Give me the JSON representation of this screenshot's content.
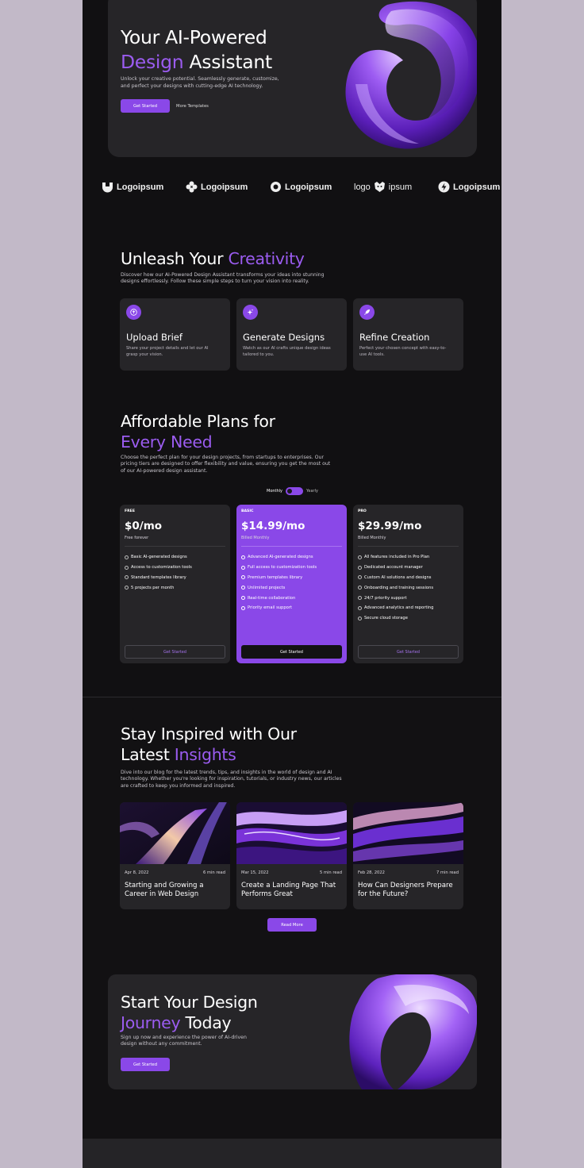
{
  "hero": {
    "title_line1": "Your AI-Powered",
    "title_accent": "Design",
    "title_rest": " Assistant",
    "subtitle": "Unlock your creative potential. Seamlessly generate, customize, and perfect your designs with cutting-edge AI technology.",
    "cta_primary": "Get Started",
    "cta_secondary": "More Templates"
  },
  "logos": [
    "Logoipsum",
    "Logoipsum",
    "Logoipsum",
    "logo",
    "ipsum",
    "Logoipsum"
  ],
  "features_section": {
    "title": "Unleash Your ",
    "title_accent": "Creativity",
    "description": "Discover how our AI-Powered Design Assistant transforms your ideas into stunning designs effortlessly. Follow these simple steps to turn your vision into reality.",
    "items": [
      {
        "icon": "upload-icon",
        "title": "Upload Brief",
        "desc": "Share your project details and let our AI grasp your vision."
      },
      {
        "icon": "sparkle-icon",
        "title": "Generate Designs",
        "desc": "Watch as our AI crafts unique design ideas tailored to you."
      },
      {
        "icon": "rocket-icon",
        "title": "Refine Creation",
        "desc": "Perfect your chosen concept with easy-to-use AI tools."
      }
    ]
  },
  "pricing": {
    "title_line1": "Affordable Plans for",
    "title_accent": "Every Need",
    "description": "Choose the perfect plan for your design projects, from startups to enterprises. Our pricing tiers are designed to offer flexibility and value, ensuring you get the most out of our AI-powered design assistant.",
    "toggle_monthly": "Monthly",
    "toggle_yearly": "Yearly",
    "plans": [
      {
        "tier": "FREE",
        "price": "$0/mo",
        "billing": "Free forever",
        "button": "Get Started",
        "features": [
          "Basic AI-generated designs",
          "Access to customization tools",
          "Standard templates library",
          "5 projects per month"
        ]
      },
      {
        "tier": "BASIC",
        "price": "$14.99/mo",
        "billing": "Billed Monthly",
        "button": "Get Started",
        "features": [
          "Advanced AI-generated designs",
          "Full access to customization tools",
          "Premium templates library",
          "Unlimited projects",
          "Real-time collaboration",
          "Priority email support"
        ]
      },
      {
        "tier": "PRO",
        "price": "$29.99/mo",
        "billing": "Billed Monthly",
        "button": "Get Started",
        "features": [
          "All features included in Pro Plan",
          "Dedicated account manager",
          "Custom AI solutions and designs",
          "Onboarding and training sessions",
          "24/7 priority support",
          "Advanced analytics and reporting",
          "Secure cloud storage"
        ]
      }
    ]
  },
  "blog": {
    "title_line1": "Stay Inspired with Our",
    "title_prefix": "Latest ",
    "title_accent": "Insights",
    "description": "Dive into our blog for the latest trends, tips, and insights in the world of design and AI technology. Whether you're looking for inspiration, tutorials, or industry news, our articles are crafted to keep you informed and inspired.",
    "posts": [
      {
        "date": "Apr 8, 2022",
        "read": "6 min read",
        "title": "Starting and Growing a Career in Web Design"
      },
      {
        "date": "Mar 15, 2022",
        "read": "5 min read",
        "title": "Create a Landing Page That Performs Great"
      },
      {
        "date": "Feb 28, 2022",
        "read": "7 min read",
        "title": "How Can Designers Prepare for the Future?"
      }
    ],
    "read_more": "Read More"
  },
  "cta": {
    "title_line1": "Start Your Design",
    "title_accent": "Journey",
    "title_rest": " Today",
    "description": "Sign up now and experience the power of AI-driven design without any commitment.",
    "button": "Get Started"
  },
  "colors": {
    "accent": "#8a48e8",
    "accent_text": "#9b5cf0",
    "background": "#111012",
    "card": "#262528",
    "outer": "#c2b9c8"
  }
}
